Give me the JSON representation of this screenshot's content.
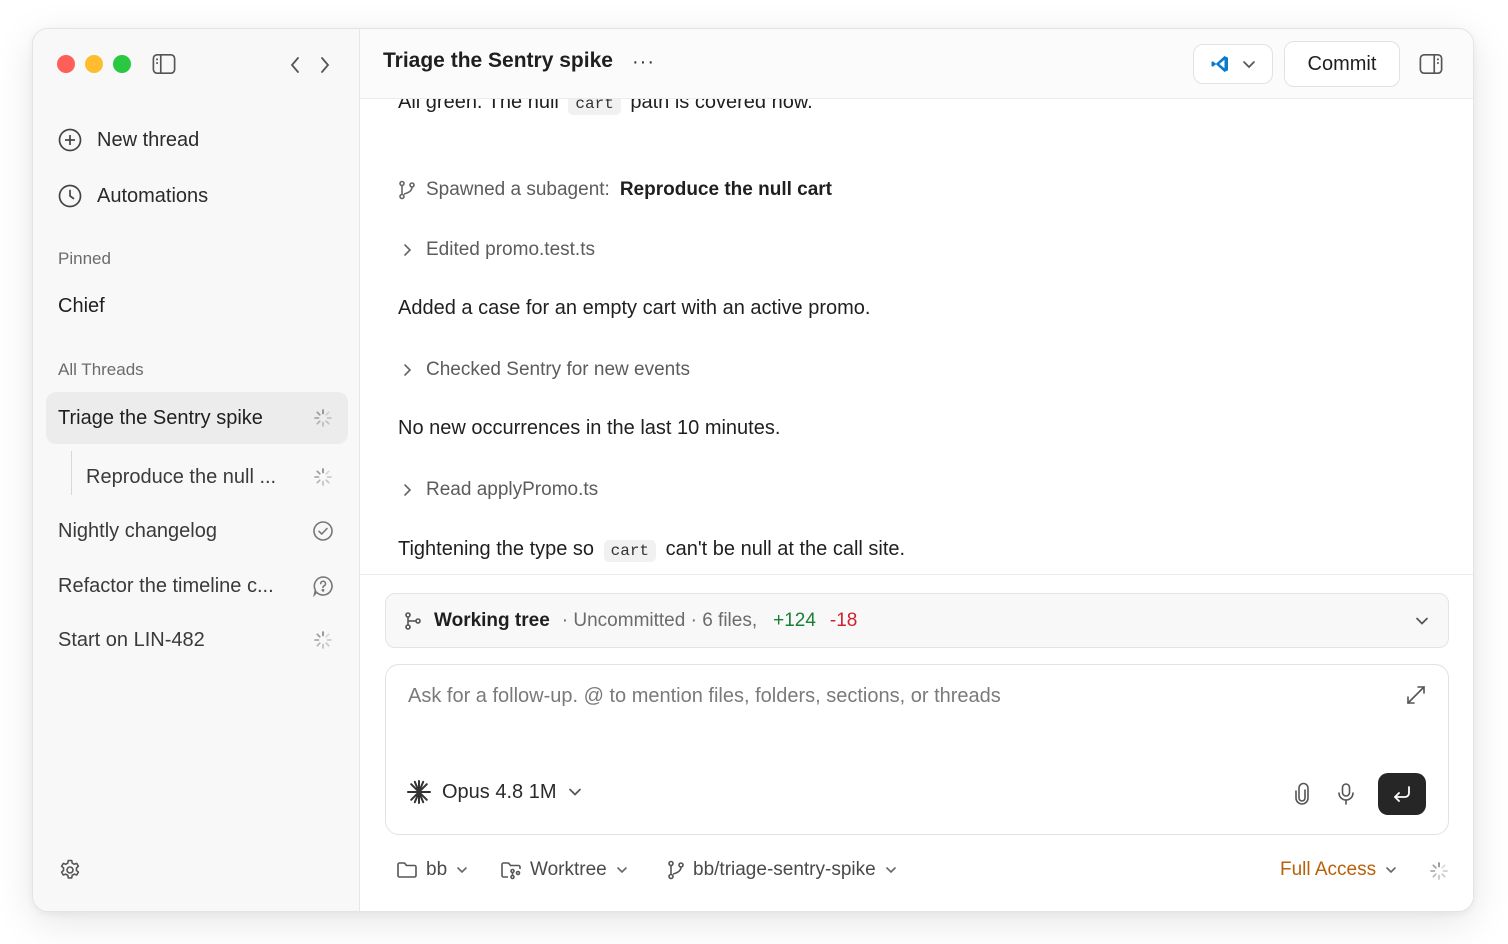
{
  "sidebar": {
    "actions": [
      {
        "label": "New thread",
        "icon": "plus-circle-icon"
      },
      {
        "label": "Automations",
        "icon": "clock-icon"
      }
    ],
    "pinned_heading": "Pinned",
    "pinned_items": [
      "Chief"
    ],
    "threads_heading": "All Threads",
    "threads": [
      {
        "label": "Triage the Sentry spike",
        "status": "spinner",
        "active": true,
        "sub": false
      },
      {
        "label": "Reproduce the null ...",
        "status": "spinner",
        "active": false,
        "sub": true
      },
      {
        "label": "Nightly changelog",
        "status": "check-circle",
        "active": false,
        "sub": false
      },
      {
        "label": "Refactor the timeline c...",
        "status": "question-bubble",
        "active": false,
        "sub": false
      },
      {
        "label": "Start on LIN-482",
        "status": "spinner",
        "active": false,
        "sub": false
      }
    ]
  },
  "header": {
    "title": "Triage the Sentry spike",
    "more": "···",
    "commit_label": "Commit",
    "editor_icon": "vscode-icon"
  },
  "conversation": {
    "msg_top": {
      "before": "All green. The null",
      "code": "cart",
      "after": "path is covered now."
    },
    "subagent": {
      "prefix": "Spawned a subagent:",
      "name": "Reproduce the null cart"
    },
    "step1": "Edited promo.test.ts",
    "msg1": "Added a case for an empty cart with an active promo.",
    "step2": "Checked Sentry for new events",
    "msg2": "No new occurrences in the last 10 minutes.",
    "step3": "Read applyPromo.ts",
    "msg3": {
      "before": "Tightening the type so",
      "code": "cart",
      "after": "can't be null at the call site."
    }
  },
  "working_tree": {
    "name": "Working tree",
    "meta": "· Uncommitted · 6 files,",
    "additions": "+124",
    "deletions": "-18"
  },
  "composer": {
    "placeholder": "Ask for a follow-up. @ to mention files, folders, sections, or threads",
    "model": "Opus 4.8 1M"
  },
  "footer": {
    "folder": "bb",
    "mode": "Worktree",
    "branch": "bb/triage-sentry-spike",
    "access": "Full Access"
  },
  "colors": {
    "accent_access": "#b8600a",
    "additions": "#1a7f37",
    "deletions": "#cf222e",
    "send_button": "#262626",
    "vscode_blue": "#0a7acc"
  }
}
